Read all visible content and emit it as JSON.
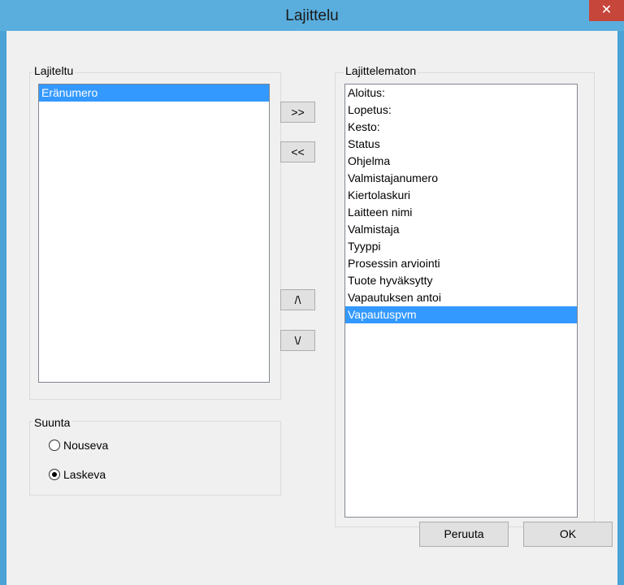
{
  "window": {
    "title": "Lajittelu",
    "close_glyph": "✕"
  },
  "sorted_group": {
    "label": "Lajiteltu",
    "items": [
      {
        "label": "Eränumero",
        "selected": true
      }
    ]
  },
  "unsorted_group": {
    "label": "Lajittelematon",
    "items": [
      {
        "label": "Aloitus:",
        "selected": false
      },
      {
        "label": "Lopetus:",
        "selected": false
      },
      {
        "label": "Kesto:",
        "selected": false
      },
      {
        "label": "Status",
        "selected": false
      },
      {
        "label": "Ohjelma",
        "selected": false
      },
      {
        "label": "Valmistajanumero",
        "selected": false
      },
      {
        "label": "Kiertolaskuri",
        "selected": false
      },
      {
        "label": "Laitteen nimi",
        "selected": false
      },
      {
        "label": "Valmistaja",
        "selected": false
      },
      {
        "label": "Tyyppi",
        "selected": false
      },
      {
        "label": "Prosessin arviointi",
        "selected": false
      },
      {
        "label": "Tuote hyväksytty",
        "selected": false
      },
      {
        "label": "Vapautuksen antoi",
        "selected": false
      },
      {
        "label": "Vapautuspvm",
        "selected": true
      }
    ]
  },
  "move_buttons": {
    "add_label": ">>",
    "remove_label": "<<",
    "up_label": "/\\",
    "down_label": "\\/"
  },
  "direction": {
    "label": "Suunta",
    "options": [
      {
        "label": "Nouseva",
        "checked": false
      },
      {
        "label": "Laskeva",
        "checked": true
      }
    ]
  },
  "footer": {
    "cancel_label": "Peruuta",
    "ok_label": "OK"
  },
  "colors": {
    "selection": "#3399ff",
    "titlebar": "#5aaede",
    "close": "#c7463b"
  }
}
